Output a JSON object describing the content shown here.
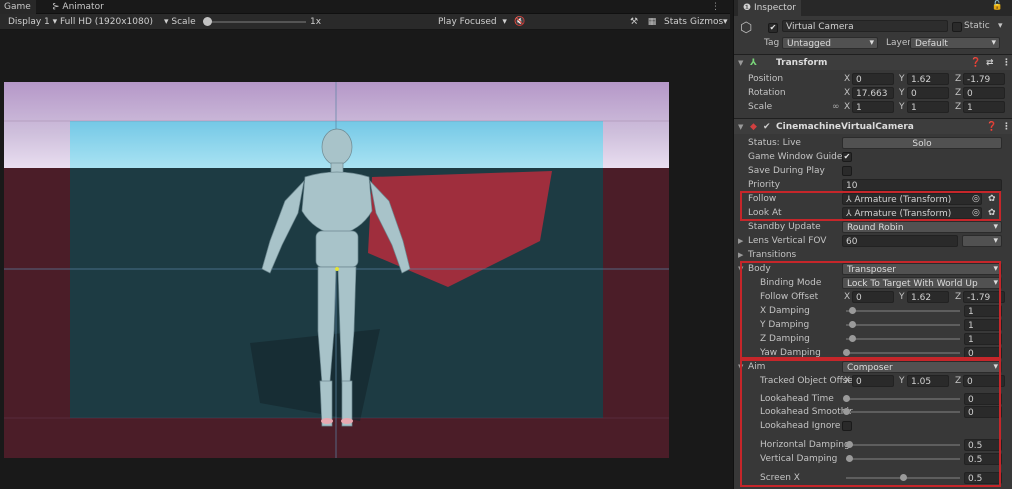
{
  "tabs": {
    "game": "Game",
    "animator": "Animator"
  },
  "gameToolbar": {
    "display": "Display 1",
    "resolution": "Full HD (1920x1080)",
    "scale_label": "Scale",
    "scale_value": "1x",
    "play_mode": "Play Focused",
    "stats": "Stats",
    "gizmos": "Gizmos"
  },
  "inspector": {
    "title": "Inspector",
    "object": {
      "name": "Virtual Camera",
      "static_label": "Static",
      "tag_label": "Tag",
      "tag": "Untagged",
      "layer_label": "Layer",
      "layer": "Default"
    },
    "transform": {
      "title": "Transform",
      "rows": [
        {
          "label": "Position",
          "x": "0",
          "y": "1.62",
          "z": "-1.79"
        },
        {
          "label": "Rotation",
          "x": "17.663",
          "y": "0",
          "z": "0"
        },
        {
          "label": "Scale",
          "x": "1",
          "y": "1",
          "z": "1"
        }
      ]
    },
    "vcam": {
      "title": "CinemachineVirtualCamera",
      "status_label": "Status: Live",
      "solo": "Solo",
      "game_window_guides": "Game Window Guides",
      "save_during_play": "Save During Play",
      "priority_label": "Priority",
      "priority": "10",
      "follow_label": "Follow",
      "follow_value": "Armature (Transform)",
      "lookat_label": "Look At",
      "lookat_value": "Armature (Transform)",
      "standby_label": "Standby Update",
      "standby_value": "Round Robin",
      "fov_label": "Lens Vertical FOV",
      "fov_value": "60",
      "transitions_label": "Transitions"
    },
    "body": {
      "label": "Body",
      "value": "Transposer",
      "binding_label": "Binding Mode",
      "binding_value": "Lock To Target With World Up",
      "offset_label": "Follow Offset",
      "offset": {
        "x": "0",
        "y": "1.62",
        "z": "-1.79"
      },
      "dampings": [
        {
          "label": "X Damping",
          "value": "1",
          "fraction": 0.05
        },
        {
          "label": "Y Damping",
          "value": "1",
          "fraction": 0.05
        },
        {
          "label": "Z Damping",
          "value": "1",
          "fraction": 0.05
        },
        {
          "label": "Yaw Damping",
          "value": "0",
          "fraction": 0.0
        }
      ]
    },
    "aim": {
      "label": "Aim",
      "value": "Composer",
      "tracked_label": "Tracked Object Offse",
      "tracked": {
        "x": "0",
        "y": "1.05",
        "z": "0"
      },
      "lookahead_time_label": "Lookahead Time",
      "lookahead_time": "0",
      "lookahead_smooth_label": "Lookahead Smoothir",
      "lookahead_smooth": "0",
      "lookahead_ignore_label": "Lookahead Ignore Y",
      "horizontal_label": "Horizontal Damping",
      "horizontal": "0.5",
      "horizontal_fraction": 0.025,
      "vertical_label": "Vertical Damping",
      "vertical": "0.5",
      "vertical_fraction": 0.025,
      "screenx_label": "Screen X",
      "screenx": "0.5",
      "screenx_fraction": 0.5
    }
  },
  "axes": {
    "x": "X",
    "y": "Y",
    "z": "Z"
  }
}
